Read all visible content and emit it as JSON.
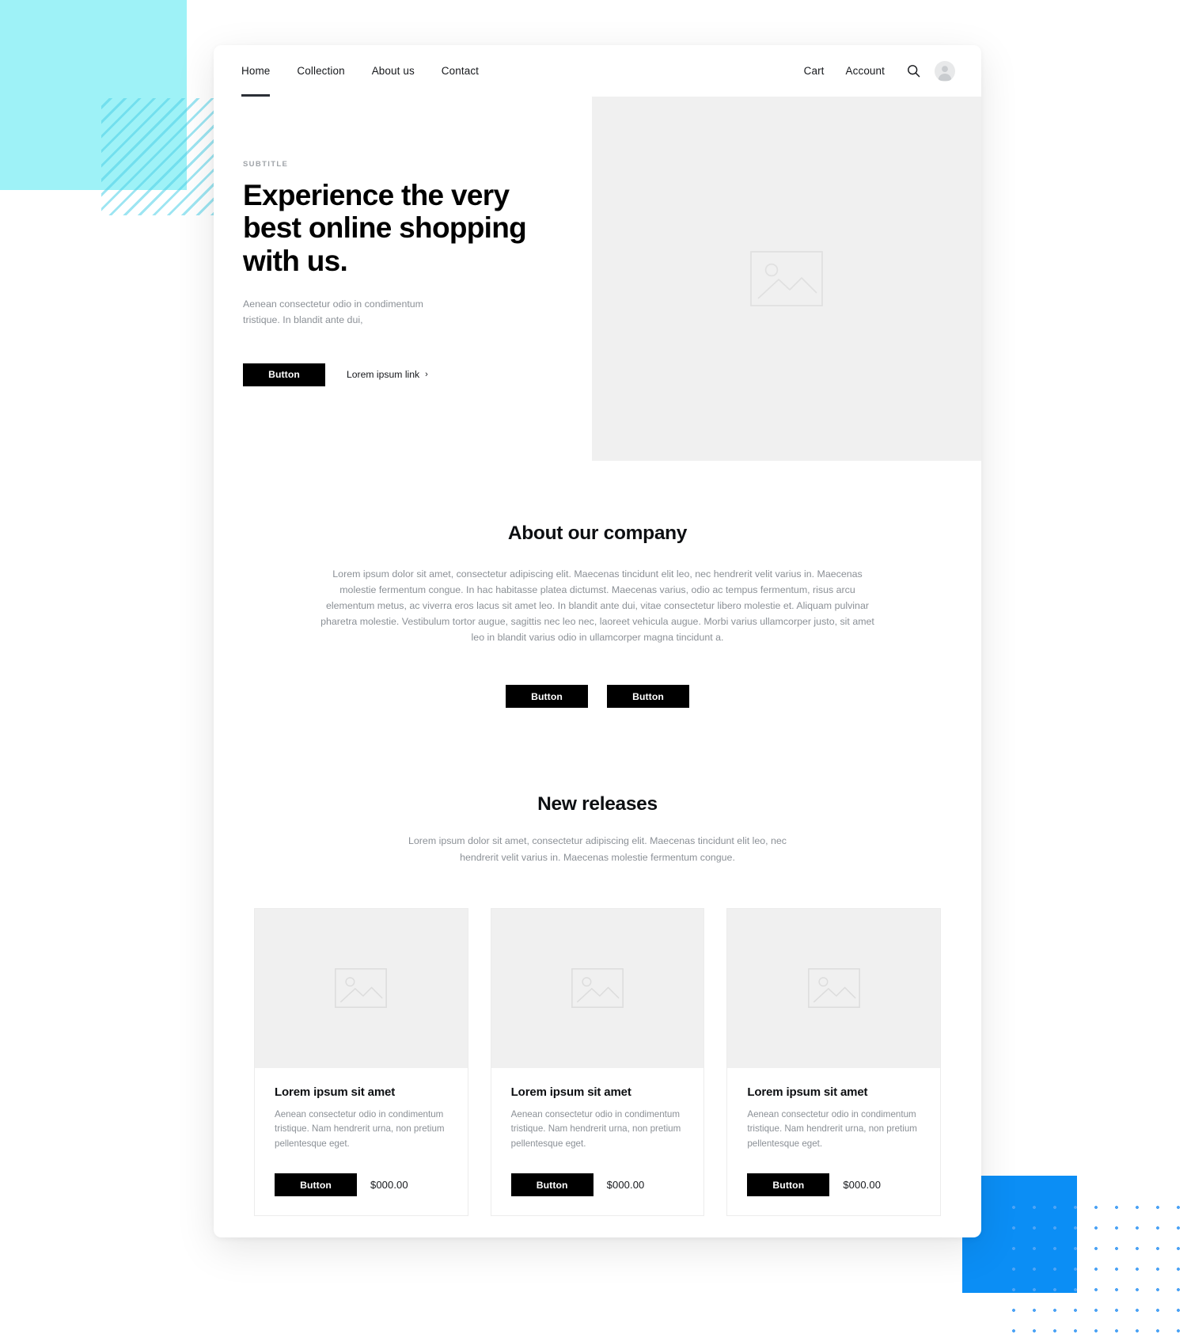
{
  "colors": {
    "cyan_square": "#9EF2F7",
    "cyan_stripes": "#4DD0E7",
    "blue_square": "#0B8EF5",
    "blue_dots": "#4DA3F5",
    "button_bg": "#000000",
    "placeholder_bg": "#F0F0F0",
    "muted_text": "#8B9096"
  },
  "nav": {
    "links": [
      {
        "label": "Home",
        "active": true
      },
      {
        "label": "Collection",
        "active": false
      },
      {
        "label": "About us",
        "active": false
      },
      {
        "label": "Contact",
        "active": false
      }
    ],
    "cart_label": "Cart",
    "account_label": "Account",
    "search_icon": "search-icon",
    "avatar_icon": "user-avatar-icon"
  },
  "hero": {
    "subtitle": "SUBTITLE",
    "title": "Experience the very best online shopping with us.",
    "description": "Aenean consectetur odio in condimentum tristique. In blandit ante dui,",
    "button_label": "Button",
    "link_label": "Lorem ipsum link",
    "link_chevron": "›",
    "media_icon": "image-placeholder-icon"
  },
  "about": {
    "heading": "About our company",
    "body": "Lorem ipsum dolor sit amet, consectetur adipiscing elit. Maecenas tincidunt elit leo, nec hendrerit velit varius in. Maecenas molestie fermentum congue. In hac habitasse platea dictumst. Maecenas varius, odio ac tempus fermentum, risus arcu elementum metus, ac viverra eros lacus sit amet leo. In blandit ante dui, vitae consectetur libero molestie et. Aliquam pulvinar pharetra molestie. Vestibulum tortor augue, sagittis nec leo nec, laoreet vehicula augue. Morbi varius ullamcorper justo, sit amet leo in blandit varius odio in ullamcorper magna tincidunt a.",
    "primary_button": "Button",
    "secondary_button": "Button"
  },
  "releases": {
    "heading": "New releases",
    "body": "Lorem ipsum dolor sit amet, consectetur adipiscing elit. Maecenas tincidunt elit leo, nec hendrerit velit varius in. Maecenas molestie fermentum congue.",
    "products": [
      {
        "title": "Lorem ipsum sit amet",
        "description": "Aenean consectetur odio in condimentum tristique. Nam hendrerit urna, non pretium pellentesque eget.",
        "button_label": "Button",
        "price": "$000.00",
        "image_icon": "image-placeholder-icon"
      },
      {
        "title": "Lorem ipsum sit amet",
        "description": "Aenean consectetur odio in condimentum tristique. Nam hendrerit urna, non pretium pellentesque eget.",
        "button_label": "Button",
        "price": "$000.00",
        "image_icon": "image-placeholder-icon"
      },
      {
        "title": "Lorem ipsum sit amet",
        "description": "Aenean consectetur odio in condimentum tristique. Nam hendrerit urna, non pretium pellentesque eget.",
        "button_label": "Button",
        "price": "$000.00",
        "image_icon": "image-placeholder-icon"
      }
    ]
  }
}
